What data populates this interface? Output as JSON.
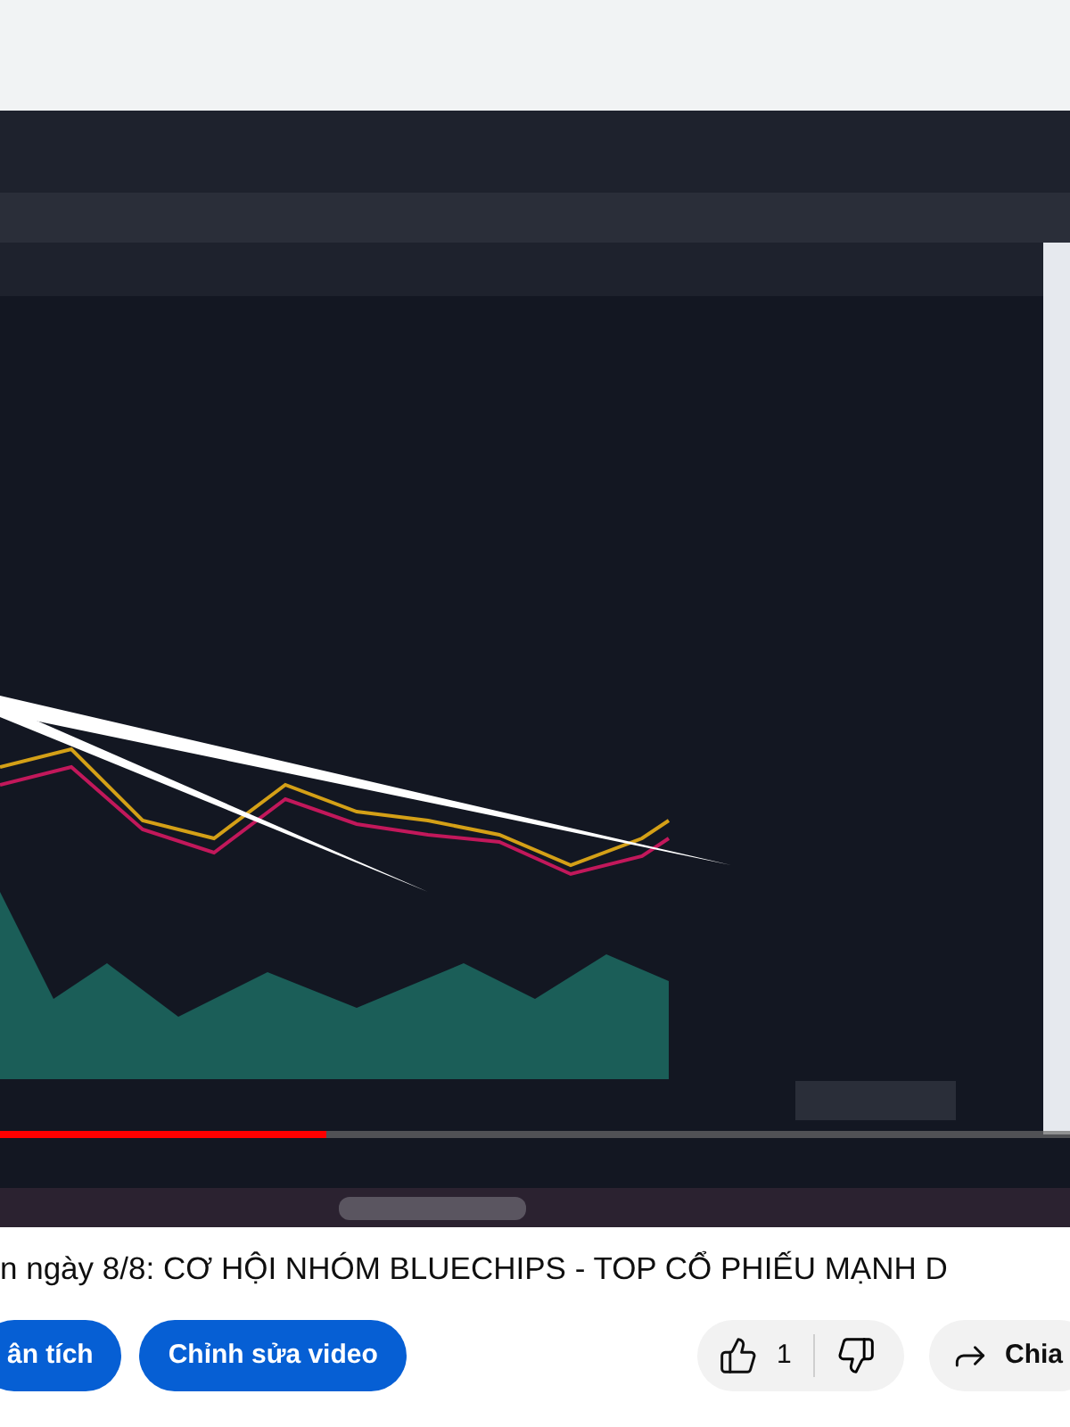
{
  "video": {
    "kind": "picture",
    "progress": {
      "level": 0.305
    }
  },
  "title": "n ngày 8/8: CƠ HỘI NHÓM BLUECHIPS - TOP CỔ PHIẾU MẠNH D",
  "actions": [
    {
      "kind": "primary",
      "label": "ân tích"
    },
    {
      "kind": "primary",
      "label": "Chỉnh sửa video"
    }
  ],
  "likes": {
    "count": "1"
  },
  "share": {
    "label": "Chia"
  }
}
